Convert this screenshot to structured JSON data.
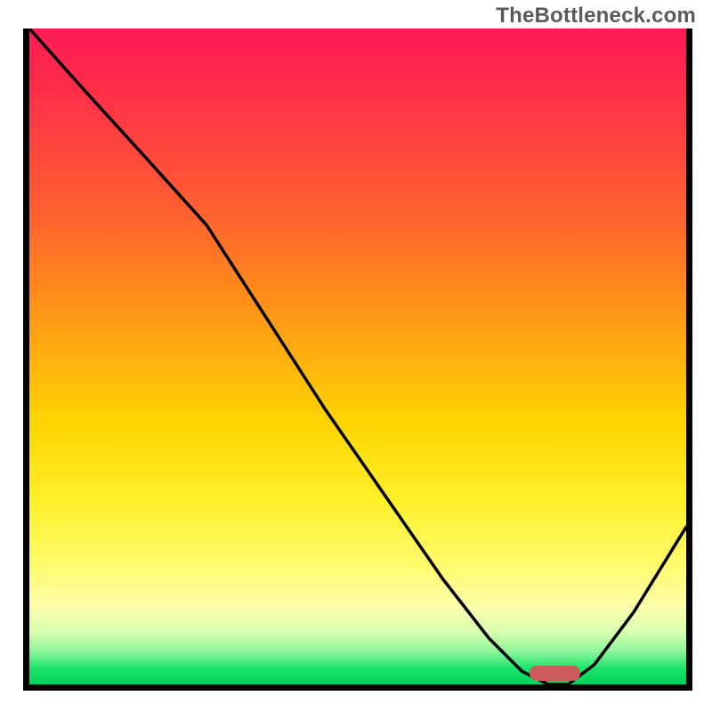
{
  "watermark": "TheBottleneck.com",
  "chart_data": {
    "type": "line",
    "title": "",
    "xlabel": "",
    "ylabel": "",
    "xlim": [
      0,
      100
    ],
    "ylim": [
      0,
      100
    ],
    "series": [
      {
        "name": "bottleneck-curve",
        "x": [
          0,
          8,
          18,
          27,
          36,
          45,
          54,
          63,
          70,
          75,
          79,
          82,
          86,
          92,
          100
        ],
        "y": [
          100,
          91,
          80,
          70,
          56,
          42,
          29,
          16,
          7,
          2,
          0,
          0,
          3,
          11,
          24
        ]
      }
    ],
    "marker": {
      "name": "optimal-range-chip",
      "x_center": 80,
      "y": 0,
      "width_pct": 7.7
    },
    "background": {
      "type": "vertical-gradient",
      "stops": [
        {
          "pct": 0,
          "color": "#ff1a55"
        },
        {
          "pct": 16,
          "color": "#ff4040"
        },
        {
          "pct": 40,
          "color": "#ff8a1a"
        },
        {
          "pct": 60,
          "color": "#ffd400"
        },
        {
          "pct": 82,
          "color": "#fffb6e"
        },
        {
          "pct": 92,
          "color": "#d8ffb0"
        },
        {
          "pct": 100,
          "color": "#00d459"
        }
      ]
    }
  }
}
